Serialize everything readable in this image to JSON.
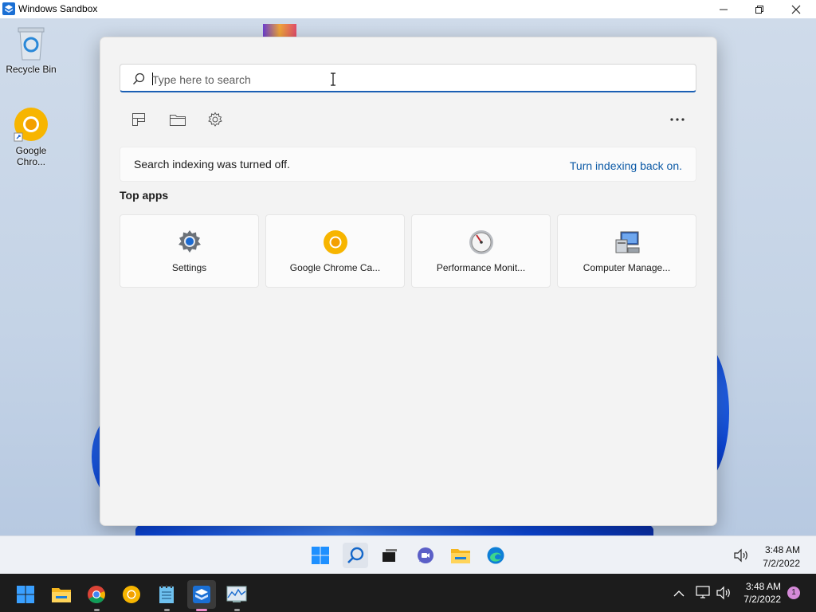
{
  "host_window": {
    "title": "Windows Sandbox",
    "icon": "windows-sandbox-icon",
    "buttons": [
      "minimize-icon",
      "restore-icon",
      "close-icon"
    ]
  },
  "desktop": {
    "icons": [
      {
        "label": "Recycle Bin",
        "icon": "recycle-bin-icon"
      },
      {
        "label": "Google Chro...",
        "icon": "chrome-canary-icon"
      }
    ]
  },
  "search": {
    "placeholder": "Type here to search",
    "toolbar": [
      "apps-icon",
      "folder-icon",
      "settings-gear-icon",
      "more-icon"
    ],
    "more_label": "...",
    "notice": {
      "message": "Search indexing was turned off.",
      "link": "Turn indexing back on."
    },
    "top_apps_heading": "Top apps",
    "top_apps": [
      {
        "name": "Settings",
        "icon": "settings-gear-icon"
      },
      {
        "name": "Google Chrome Ca...",
        "icon": "chrome-canary-icon"
      },
      {
        "name": "Performance Monit...",
        "icon": "performance-monitor-icon"
      },
      {
        "name": "Computer Manage...",
        "icon": "computer-management-icon"
      }
    ]
  },
  "guest_taskbar": {
    "apps": [
      "start-icon",
      "search-icon",
      "task-view-icon",
      "teams-chat-icon",
      "file-explorer-icon",
      "edge-icon"
    ],
    "time": "3:48 AM",
    "date": "7/2/2022"
  },
  "host_taskbar": {
    "apps": [
      "start-icon",
      "file-explorer-icon",
      "chrome-icon",
      "chrome-canary-icon",
      "notepad-icon",
      "windows-sandbox-icon",
      "resource-monitor-icon"
    ],
    "time": "3:48 AM",
    "date": "7/2/2022",
    "notification_count": "1"
  },
  "colors": {
    "accent": "#1a5fb4",
    "link": "#0c5aa6",
    "flyout_bg": "#f3f3f3",
    "host_taskbar_bg": "#1c1c1c"
  }
}
